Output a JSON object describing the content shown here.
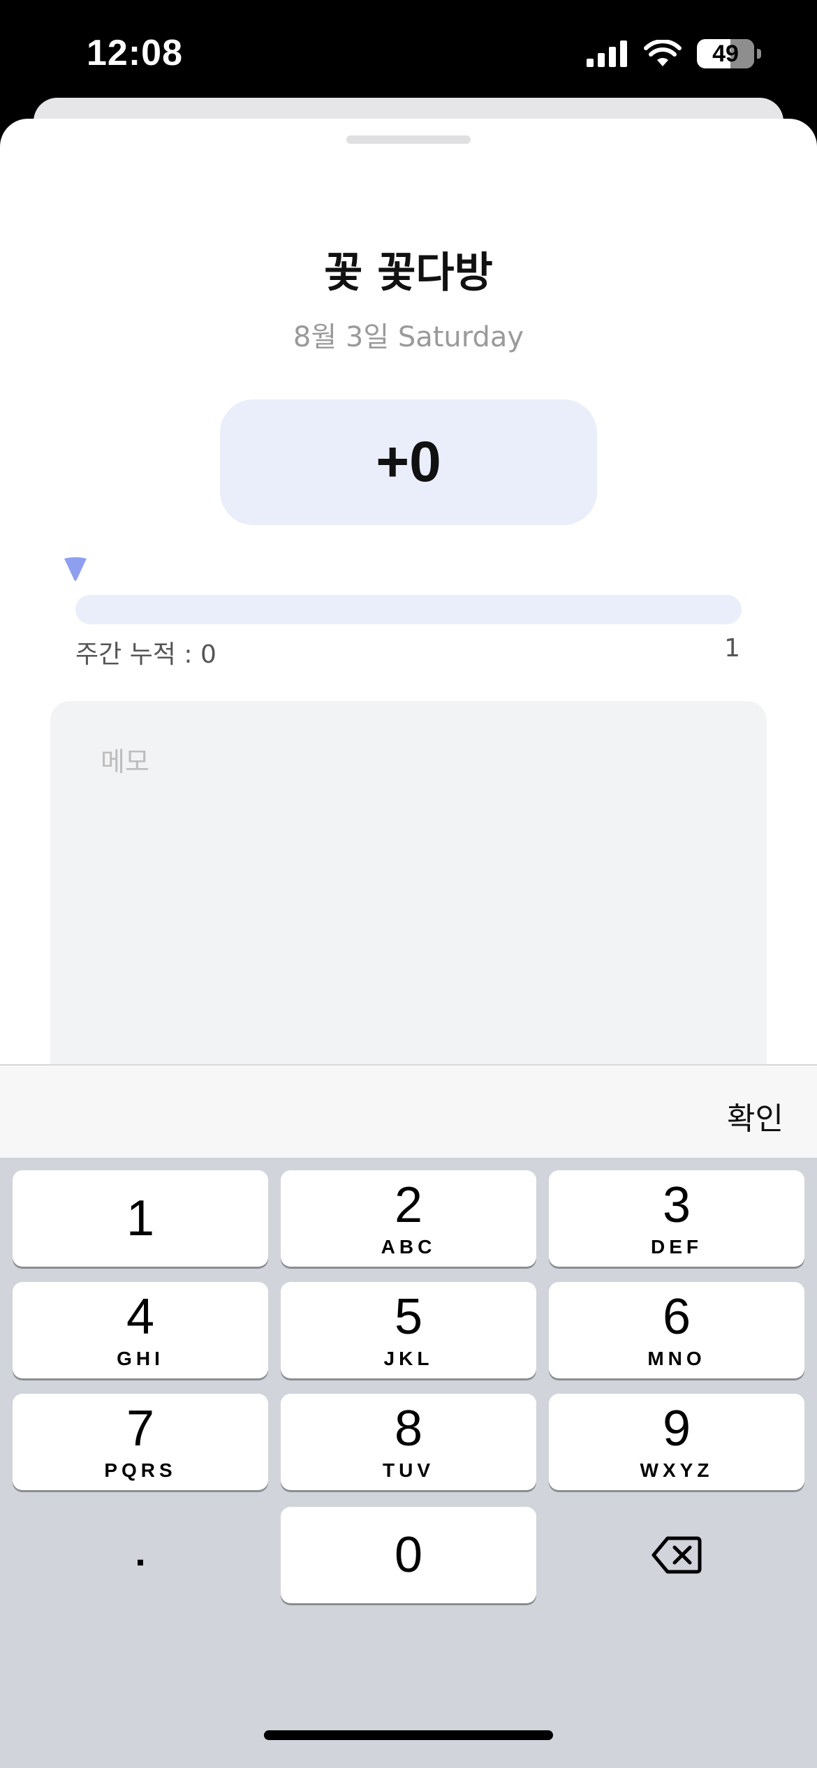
{
  "status": {
    "time": "12:08",
    "battery": "49"
  },
  "sheet": {
    "title": "꽃 꽃다방",
    "date": "8월 3일 Saturday",
    "value": "+0",
    "progress": {
      "label_left": "주간 누적 : 0",
      "label_right": "1",
      "fraction": 0
    },
    "memo": {
      "placeholder": "메모",
      "value": ""
    }
  },
  "accessory": {
    "confirm_label": "확인"
  },
  "keyboard": {
    "keys": [
      {
        "num": "1",
        "letters": ""
      },
      {
        "num": "2",
        "letters": "ABC"
      },
      {
        "num": "3",
        "letters": "DEF"
      },
      {
        "num": "4",
        "letters": "GHI"
      },
      {
        "num": "5",
        "letters": "JKL"
      },
      {
        "num": "6",
        "letters": "MNO"
      },
      {
        "num": "7",
        "letters": "PQRS"
      },
      {
        "num": "8",
        "letters": "TUV"
      },
      {
        "num": "9",
        "letters": "WXYZ"
      },
      {
        "num": "0",
        "letters": ""
      }
    ],
    "decimal": ".",
    "delete_icon": "backspace-icon"
  },
  "colors": {
    "accent": "#8f9ff0",
    "value_box": "#eaeefa",
    "memo_bg": "#f2f3f5",
    "keyboard_bg": "#d1d4db"
  }
}
